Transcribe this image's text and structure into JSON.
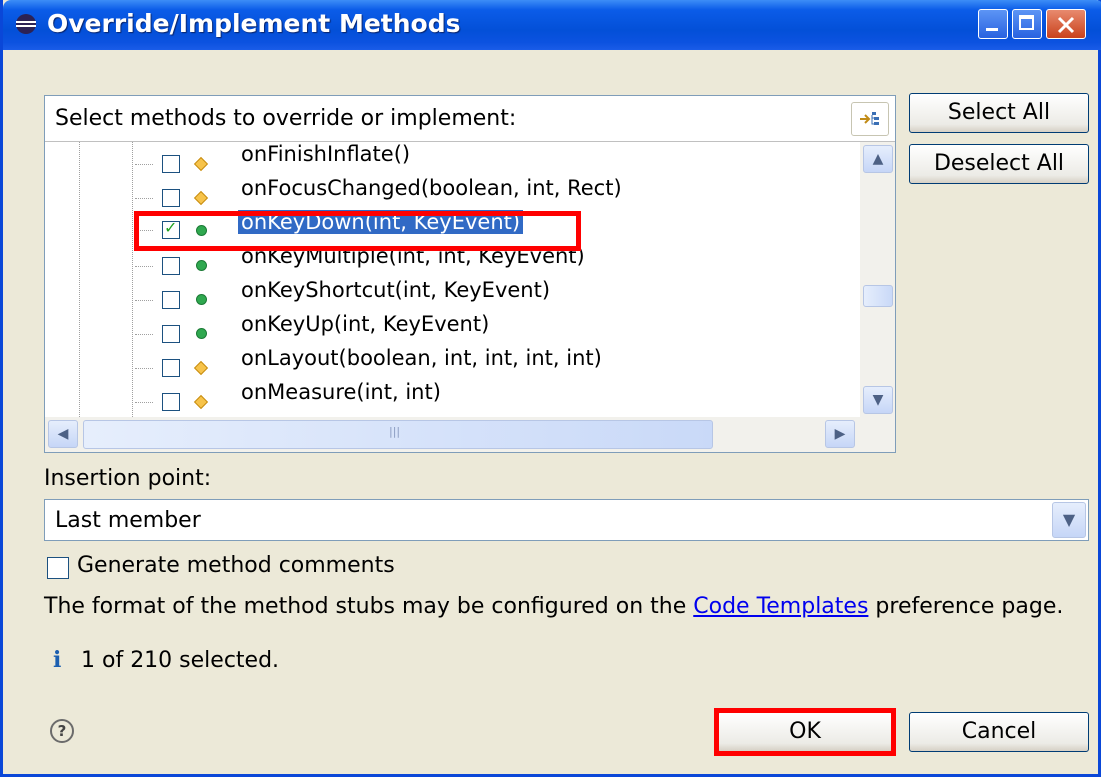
{
  "window": {
    "title": "Override/Implement Methods"
  },
  "list": {
    "header": "Select methods to override or implement:",
    "methods": [
      {
        "name": "onFinishInflate()",
        "checked": false,
        "kind": "diamond",
        "selected": false
      },
      {
        "name": "onFocusChanged(boolean, int, Rect)",
        "checked": false,
        "kind": "diamond",
        "selected": false
      },
      {
        "name": "onKeyDown(int, KeyEvent)",
        "checked": true,
        "kind": "dot",
        "selected": true
      },
      {
        "name": "onKeyMultiple(int, int, KeyEvent)",
        "checked": false,
        "kind": "dot",
        "selected": false
      },
      {
        "name": "onKeyShortcut(int, KeyEvent)",
        "checked": false,
        "kind": "dot",
        "selected": false
      },
      {
        "name": "onKeyUp(int, KeyEvent)",
        "checked": false,
        "kind": "dot",
        "selected": false
      },
      {
        "name": "onLayout(boolean, int, int, int, int)",
        "checked": false,
        "kind": "diamond",
        "selected": false
      },
      {
        "name": "onMeasure(int, int)",
        "checked": false,
        "kind": "diamond",
        "selected": false
      }
    ]
  },
  "buttons": {
    "select_all": "Select All",
    "deselect_all": "Deselect All",
    "ok": "OK",
    "cancel": "Cancel"
  },
  "insertion": {
    "label": "Insertion point:",
    "value": "Last member"
  },
  "options": {
    "generate_comments": "Generate method comments",
    "generate_comments_checked": false
  },
  "info": {
    "format_prefix": "The format of the method stubs may be configured on the",
    "format_link": "Code Templates",
    "format_suffix": "preference page.",
    "status": "1 of 210 selected."
  },
  "icons": {
    "title": "eclipse-icon",
    "help": "help-icon",
    "info": "info-icon",
    "sort": "sort-icon"
  },
  "colors": {
    "titlebar": "#0350d8",
    "selection": "#316ac5",
    "highlight_box": "#ff0000"
  }
}
